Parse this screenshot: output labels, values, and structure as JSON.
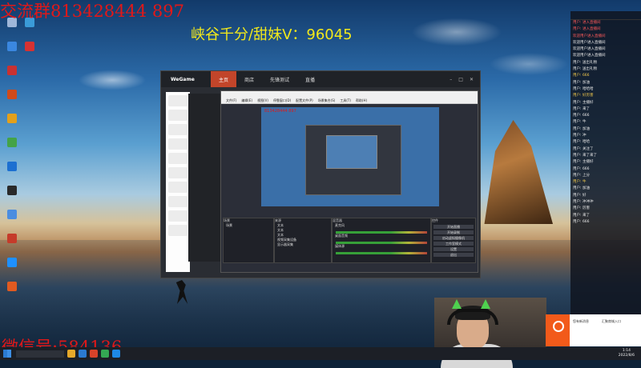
{
  "overlay": {
    "top_left": "交流群813428444 897",
    "center": "峡谷千分/甜妹V：96045",
    "bottom_left": "微信号:584136"
  },
  "desktop_icons": [
    {
      "icon": "recycle-bin-icon",
      "color": "#9fb7d9"
    },
    {
      "icon": "app-icon",
      "color": "#3a87e0"
    },
    {
      "icon": "app-icon",
      "color": "#c83232"
    },
    {
      "icon": "app-icon",
      "color": "#d04a1a"
    },
    {
      "icon": "app-icon",
      "color": "#e3a01b"
    },
    {
      "icon": "app-icon",
      "color": "#44a348"
    },
    {
      "icon": "app-icon",
      "color": "#1c6fd1"
    },
    {
      "icon": "app-icon",
      "color": "#2a2a2a"
    },
    {
      "icon": "app-icon",
      "color": "#4b8de0"
    },
    {
      "icon": "app-icon",
      "color": "#c53b2a"
    },
    {
      "icon": "app-icon",
      "color": "#1e90ff"
    },
    {
      "icon": "app-icon",
      "color": "#e05a20"
    },
    {
      "icon": "app-icon",
      "color": "#3a9bd8"
    },
    {
      "icon": "app-icon",
      "color": "#d63232"
    }
  ],
  "wegame": {
    "logo": "WeGame",
    "tabs": [
      {
        "label": "主页",
        "active": true
      },
      {
        "label": "商店",
        "active": false
      },
      {
        "label": "先锋测试",
        "active": false
      },
      {
        "label": "直播",
        "active": false
      }
    ]
  },
  "obs": {
    "menu": [
      "文件(F)",
      "编辑(E)",
      "视图(V)",
      "停靠窗口(D)",
      "配置文件(P)",
      "场景集合(S)",
      "工具(T)",
      "帮助(H)"
    ],
    "preview_text": "813428444 897",
    "dock_labels": {
      "scenes": "场景",
      "sources": "来源",
      "mixer": "混音器",
      "controls": "控件"
    },
    "scene_item": "场景",
    "sources": [
      "文本",
      "文本",
      "文本",
      "视频采集设备",
      "显示器采集"
    ],
    "mixer": [
      "麦克风",
      "桌面音频",
      "媒体源"
    ],
    "controls": [
      "开始直播",
      "开始录制",
      "启动虚拟摄像机",
      "工作室模式",
      "设置",
      "退出"
    ]
  },
  "chat": {
    "messages": [
      {
        "text": "用户: 进入直播间",
        "style": "red"
      },
      {
        "text": "用户: 进入直播间",
        "style": "red"
      },
      {
        "text": "欢迎用户进入直播间",
        "style": "red"
      },
      {
        "text": "欢迎用户进入直播间",
        "style": ""
      },
      {
        "text": "欢迎用户进入直播间",
        "style": ""
      },
      {
        "text": "欢迎用户进入直播间",
        "style": ""
      },
      {
        "text": "用户: 送出礼物",
        "style": ""
      },
      {
        "text": "用户: 送出礼物",
        "style": ""
      },
      {
        "text": "用户: 666",
        "style": "yel"
      },
      {
        "text": "用户: 加油",
        "style": ""
      },
      {
        "text": "用户: 哈哈哈",
        "style": ""
      },
      {
        "text": "用户: 好厉害",
        "style": "yel"
      },
      {
        "text": "用户: 主播好",
        "style": ""
      },
      {
        "text": "用户: 来了",
        "style": ""
      },
      {
        "text": "用户: 666",
        "style": ""
      },
      {
        "text": "用户: 牛",
        "style": ""
      },
      {
        "text": "用户: 加油",
        "style": ""
      },
      {
        "text": "用户: 冲",
        "style": ""
      },
      {
        "text": "用户: 哈哈",
        "style": ""
      },
      {
        "text": "用户: 关注了",
        "style": ""
      },
      {
        "text": "用户: 来了来了",
        "style": ""
      },
      {
        "text": "用户: 主播好",
        "style": ""
      },
      {
        "text": "用户: 666",
        "style": ""
      },
      {
        "text": "用户: 上分",
        "style": ""
      },
      {
        "text": "用户: 牛",
        "style": "yel"
      },
      {
        "text": "用户: 加油",
        "style": ""
      },
      {
        "text": "用户: 好",
        "style": ""
      },
      {
        "text": "用户: 冲冲冲",
        "style": ""
      },
      {
        "text": "用户: 厉害",
        "style": ""
      },
      {
        "text": "用户: 来了",
        "style": ""
      },
      {
        "text": "用户: 666",
        "style": ""
      }
    ]
  },
  "notification": {
    "title": "您有新消息",
    "body": "汇聚商城入口"
  },
  "taskbar": {
    "apps": [
      "#e6a82a",
      "#2b7ad1",
      "#d9432a",
      "#34a853",
      "#1e88e5"
    ],
    "time": "1:14",
    "date": "2022/8/6"
  }
}
